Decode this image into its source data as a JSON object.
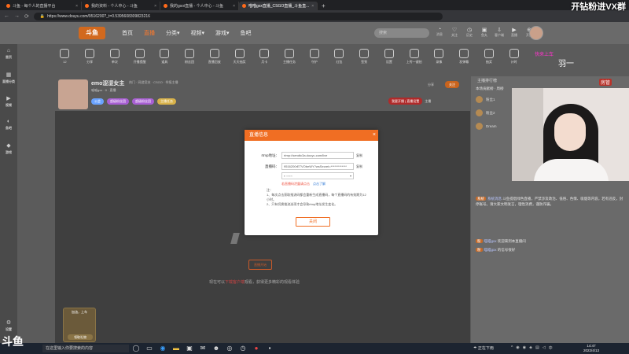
{
  "browser": {
    "tabs": [
      {
        "label": "斗鱼 - 每个人的直播平台",
        "active": false
      },
      {
        "label": "我的资料 - 个人中心 - 斗鱼",
        "active": false
      },
      {
        "label": "我的gsoi直播 - 个人中心 - 斗鱼",
        "active": false
      },
      {
        "label": "喵喵gxx直播_CSGO直播_斗鱼直...",
        "active": true
      }
    ],
    "url": "https://www.douyu.com/9516200?_t=0.5395608309823216"
  },
  "watermark": "开钻粉进VX群",
  "site": {
    "logo": "斗鱼",
    "menu": [
      "首页",
      "直播",
      "分类▾",
      "视频▾",
      "游戏▾",
      "鱼吧"
    ],
    "search_placeholder": "搜索",
    "header_icons": [
      {
        "icon": "bell-icon",
        "label": "消息"
      },
      {
        "icon": "heart-icon",
        "label": "关注"
      },
      {
        "icon": "history-icon",
        "label": "历史"
      },
      {
        "icon": "gift-icon",
        "label": "鱼丸"
      },
      {
        "icon": "download-icon",
        "label": "客户端"
      },
      {
        "icon": "play-icon",
        "label": "直播"
      },
      {
        "icon": "plus-icon",
        "label": "开播"
      }
    ],
    "rail": [
      {
        "icon": "home-icon",
        "label": "首页"
      },
      {
        "icon": "grid-icon",
        "label": "直播分类"
      },
      {
        "icon": "video-icon",
        "label": "视频"
      },
      {
        "icon": "fish-icon",
        "label": "鱼吧"
      },
      {
        "icon": "game-icon",
        "label": "游戏"
      }
    ],
    "rail_bottom": "设置",
    "activity_bar": [
      {
        "label": "12"
      },
      {
        "label": "分享"
      },
      {
        "label": "单次"
      },
      {
        "label": "开播提醒"
      },
      {
        "label": "道具"
      },
      {
        "label": "粉丝团"
      },
      {
        "label": "直播回放"
      },
      {
        "label": "天天抽奖"
      },
      {
        "label": "月卡"
      },
      {
        "label": "主播任务"
      },
      {
        "label": "守护"
      },
      {
        "label": "红包"
      },
      {
        "label": "签到"
      },
      {
        "label": "设置"
      },
      {
        "label": "上传一键拍"
      },
      {
        "label": "录像"
      },
      {
        "label": "发弹幕"
      },
      {
        "label": "抽奖"
      },
      {
        "label": "计时"
      }
    ],
    "streamer": {
      "title": "emo涩涩女主",
      "category": "热门 · 网游竞技 · CSGO · 举报主播",
      "meta": "喵喵gxx · 0 · 直播",
      "badges": [
        {
          "text": "公会",
          "color": "#6aa3ff"
        },
        {
          "text": "超级粉丝团",
          "color": "#a85fd3"
        },
        {
          "text": "超级粉丝团",
          "color": "#a85fd3"
        },
        {
          "text": "主播任务",
          "color": "#d8b24a"
        }
      ],
      "report_button": "我要开播 | 直播设置",
      "report_extra": "主播",
      "share_label": "分享",
      "follow_label": "关注"
    },
    "player": {
      "start_button": "直播开始",
      "hint_prefix": "现在可以",
      "hint_highlight": "下载客户端",
      "hint_suffix": "观看，获得更多精彩的观看体验",
      "gift_title": "加油，上车",
      "gift_button": "领取礼物"
    },
    "chat": {
      "header": "主播排行榜",
      "rank_title": "本场贡献榜 · 周榜",
      "ranks": [
        {
          "name": "粉丝1"
        },
        {
          "name": "粉丝2"
        },
        {
          "name": "Dream"
        }
      ],
      "messages": [
        {
          "level": "系统",
          "user": "系统消息",
          "text": "斗鱼提倡绿色直播，严禁涉及政治、低俗、色情、吸烟等内容，若有违反，封停账号。请大家文明发言，理性消费，谨防诈骗。"
        },
        {
          "level": "粉",
          "user": "喵喵gxx",
          "text": "欢迎来到本直播间"
        },
        {
          "level": "粉",
          "user": "喵喵gxx",
          "text": "的信号很好"
        }
      ]
    },
    "overlay": {
      "deco_caption": "快来上车",
      "deco_name": "羽一",
      "fangguan": "房管"
    }
  },
  "modal": {
    "title": "直播信息",
    "rows": [
      {
        "label": "rtmp地址：",
        "value": "rtmp://sendtc3a.douyu.com/live",
        "copy": "复制"
      },
      {
        "label": "直播码：",
        "value": "9516200rETVObeWY?wsSecret=*************",
        "copy": "复制"
      }
    ],
    "select_value": "▪ ▫▫▫▫▫▫",
    "warning": "若直播码泄露请点击",
    "warning_link": "点击了解",
    "notes": [
      "注：",
      "1、每次点击获取推流码都会重新生成直播码，每个直播码的有效期为12小时。",
      "2、只有切换推流选项才会导致rtmp地址发生变化。"
    ],
    "ok": "关闭"
  },
  "taskbar": {
    "logo": "斗鱼",
    "search_placeholder": "在这里输入你要搜索的内容",
    "weather": "正在下雨",
    "time": "14:47",
    "date": "2022/4/13"
  }
}
